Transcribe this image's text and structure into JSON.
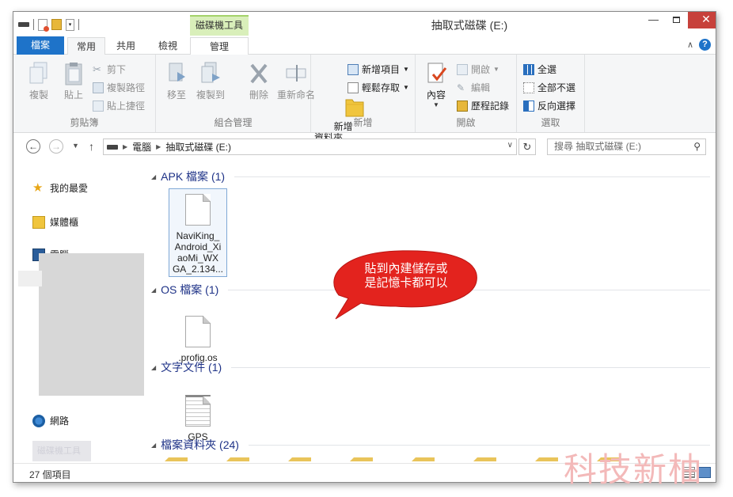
{
  "window": {
    "title": "抽取式磁碟 (E:)",
    "context_tab_group": "磁碟機工具",
    "controls": {
      "minimize": "—",
      "close": "✕"
    }
  },
  "quick_access": {
    "dropdown": "▾"
  },
  "tabs": [
    {
      "label": "檔案",
      "state": "file"
    },
    {
      "label": "常用",
      "state": "active"
    },
    {
      "label": "共用",
      "state": ""
    },
    {
      "label": "檢視",
      "state": ""
    },
    {
      "label": "管理",
      "state": ""
    }
  ],
  "ribbon": {
    "clipboard": {
      "label": "剪貼簿",
      "copy": "複製",
      "paste": "貼上",
      "cut": "剪下",
      "copy_path": "複製路徑",
      "paste_shortcut": "貼上捷徑"
    },
    "organize": {
      "label": "組合管理",
      "move_to": "移至",
      "copy_to": "複製到",
      "delete": "刪除",
      "rename": "重新命名"
    },
    "new": {
      "label": "新增",
      "new_folder": "新增\n資料夾",
      "new_item": "新增項目",
      "easy_access": "輕鬆存取"
    },
    "open": {
      "label": "開啟",
      "properties": "內容",
      "open": "開啟",
      "edit": "編輯",
      "history": "歷程記錄"
    },
    "select": {
      "label": "選取",
      "select_all": "全選",
      "select_none": "全部不選",
      "invert": "反向選擇"
    }
  },
  "address": {
    "crumbs": [
      "電腦",
      "抽取式磁碟 (E:)"
    ],
    "search_placeholder": "搜尋 抽取式磁碟 (E:)"
  },
  "nav_pane": {
    "items": [
      "我的最愛",
      "媒體櫃",
      "電腦",
      "網路"
    ],
    "blurred_item": "磁碟機工具"
  },
  "groups": [
    {
      "header": "APK 檔案 (1)",
      "files": [
        {
          "name": "NaviKing_\nAndroid_Xi\naoMi_WX\nGA_2.134..."
        }
      ]
    },
    {
      "header": "OS 檔案 (1)",
      "files": [
        {
          "name": ".profig.os"
        }
      ]
    },
    {
      "header": "文字文件 (1)",
      "files": [
        {
          "name": "GPS"
        }
      ]
    },
    {
      "header": "檔案資料夾 (24)",
      "files": []
    }
  ],
  "callout": {
    "text_line1": "貼到內建儲存或",
    "text_line2": "是記憶卡都可以",
    "color": "#e3231e"
  },
  "status": {
    "item_count": "27 個項目"
  },
  "watermark": "科技新柚",
  "colors": {
    "accent": "#1e73c9",
    "context_tab": "#d9efba",
    "group_header": "#1e3287"
  }
}
